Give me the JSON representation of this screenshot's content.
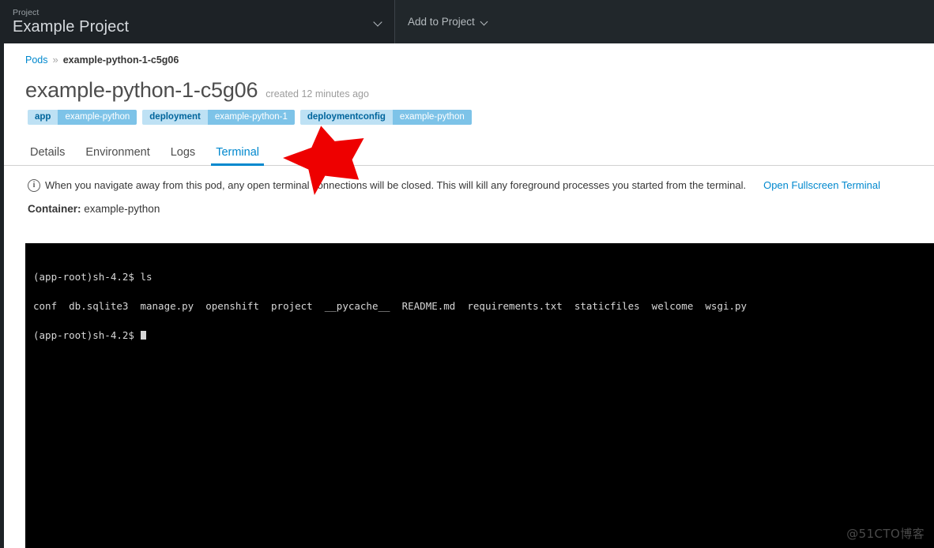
{
  "topbar": {
    "project_kicker": "Project",
    "project_name": "Example Project",
    "project_caret_icon": "chevron-down-icon",
    "add_to_project_label": "Add to Project",
    "add_caret_icon": "chevron-down-icon"
  },
  "breadcrumb": {
    "root_label": "Pods",
    "separator": "»",
    "current_label": "example-python-1-c5g06"
  },
  "page": {
    "title": "example-python-1-c5g06",
    "subtitle": "created 12 minutes ago"
  },
  "labels": [
    {
      "key": "app",
      "value": "example-python"
    },
    {
      "key": "deployment",
      "value": "example-python-1"
    },
    {
      "key": "deploymentconfig",
      "value": "example-python"
    }
  ],
  "tabs": [
    {
      "label": "Details",
      "active": false
    },
    {
      "label": "Environment",
      "active": false
    },
    {
      "label": "Logs",
      "active": false
    },
    {
      "label": "Terminal",
      "active": true
    }
  ],
  "notice": {
    "icon": "info-circle-icon",
    "text": "When you navigate away from this pod, any open terminal connections will be closed. This will kill any foreground processes you started from the terminal.",
    "link_label": "Open Fullscreen Terminal"
  },
  "container": {
    "label": "Container:",
    "name": "example-python"
  },
  "terminal": {
    "lines": [
      "(app-root)sh-4.2$ ls",
      "conf  db.sqlite3  manage.py  openshift  project  __pycache__  README.md  requirements.txt  staticfiles  welcome  wsgi.py",
      "(app-root)sh-4.2$ "
    ]
  },
  "annotation": {
    "arrow_icon": "red-arrow-pointing-down-left",
    "arrow_color": "#ee0000"
  },
  "watermark": {
    "text": "@51CTO博客"
  },
  "colors": {
    "accent": "#0088ce",
    "topbar_bg": "#1d2226",
    "tag_key_bg": "#bee1f4",
    "tag_value_bg": "#7dc3e8",
    "terminal_bg": "#000000"
  }
}
